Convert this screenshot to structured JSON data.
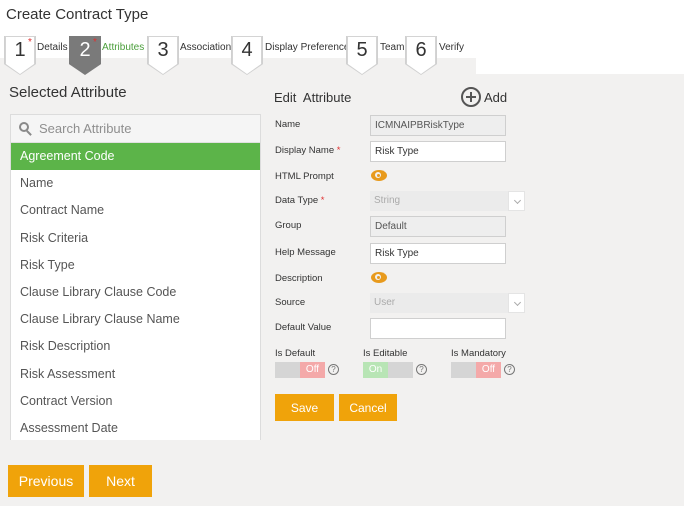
{
  "page": {
    "title": "Create Contract Type"
  },
  "steps": [
    {
      "number": "1",
      "label": "Details",
      "required": true,
      "active": false
    },
    {
      "number": "2",
      "label": "Attributes",
      "required": true,
      "active": true
    },
    {
      "number": "3",
      "label": "Association",
      "required": false,
      "active": false
    },
    {
      "number": "4",
      "label": "Display Preference",
      "required": false,
      "active": false
    },
    {
      "number": "5",
      "label": "Team",
      "required": false,
      "active": false
    },
    {
      "number": "6",
      "label": "Verify",
      "required": false,
      "active": false
    }
  ],
  "left_panel": {
    "title": "Selected Attribute",
    "search_placeholder": "Search Attribute",
    "search_icon": "search-icon",
    "selected_color": "#5cb449",
    "items": [
      {
        "label": "Agreement Code",
        "selected": true
      },
      {
        "label": "Name",
        "selected": false
      },
      {
        "label": "Contract Name",
        "selected": false
      },
      {
        "label": "Risk Criteria",
        "selected": false
      },
      {
        "label": "Risk Type",
        "selected": false
      },
      {
        "label": "Clause Library Clause Code",
        "selected": false
      },
      {
        "label": "Clause Library Clause Name",
        "selected": false
      },
      {
        "label": "Risk Description",
        "selected": false
      },
      {
        "label": "Risk Assessment",
        "selected": false
      },
      {
        "label": "Contract Version",
        "selected": false
      },
      {
        "label": "Assessment Date",
        "selected": false
      }
    ]
  },
  "edit_panel": {
    "title": "Edit  Attribute",
    "add_label": "Add",
    "add_icon": "plus-circle-icon",
    "fields": {
      "name": {
        "label": "Name",
        "value": "ICMNAIPBRiskType"
      },
      "display_name": {
        "label": "Display Name",
        "required_mark": "*",
        "value": "Risk Type"
      },
      "html_prompt": {
        "label": "HTML Prompt",
        "icon": "eye-icon"
      },
      "data_type": {
        "label": "Data Type",
        "required_mark": "*",
        "value": "String"
      },
      "group": {
        "label": "Group",
        "value": "Default"
      },
      "help_message": {
        "label": "Help Message",
        "value": "Risk Type"
      },
      "description": {
        "label": "Description",
        "icon": "eye-icon"
      },
      "source": {
        "label": "Source",
        "value": "User"
      },
      "default_value": {
        "label": "Default Value",
        "value": ""
      }
    },
    "toggles": [
      {
        "label": "Is Default",
        "state": "Off",
        "help": "?"
      },
      {
        "label": "Is Editable",
        "state": "On",
        "help": "?"
      },
      {
        "label": "Is Mandatory",
        "state": "Off",
        "help": "?"
      }
    ],
    "save_label": "Save",
    "cancel_label": "Cancel"
  },
  "footer": {
    "previous_label": "Previous",
    "next_label": "Next"
  },
  "colors": {
    "accent": "#f0a30a",
    "active_step": "#7a7a7a",
    "active_step_label": "#4a9e3a",
    "required": "#e03030",
    "eye": "#e89a1c",
    "background": "#f2f1f0"
  }
}
